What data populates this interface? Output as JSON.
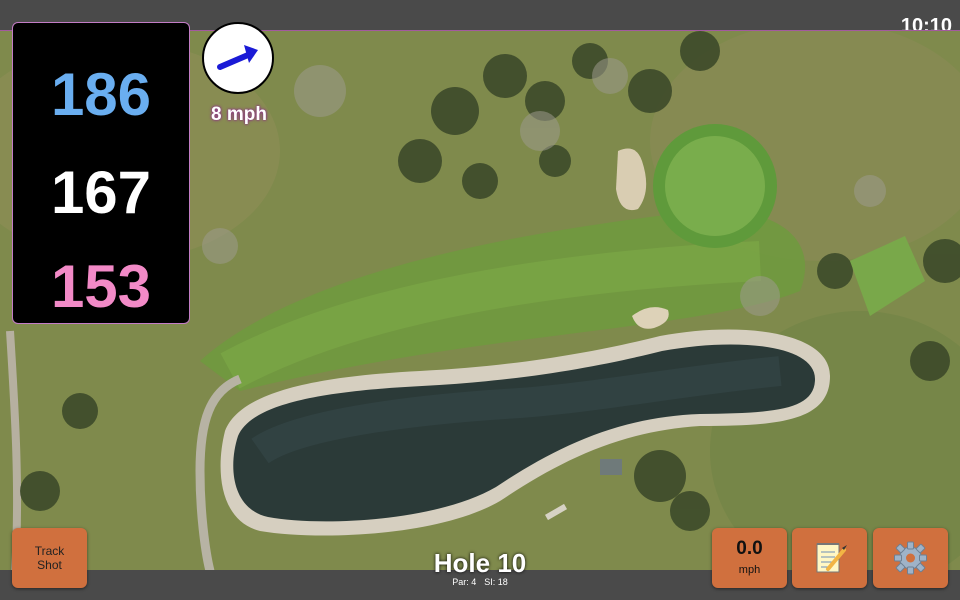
{
  "status": {
    "clock": "10:10"
  },
  "distances": {
    "back": "186",
    "middle": "167",
    "front": "153"
  },
  "wind": {
    "speed": "8 mph",
    "arrow_color": "#1a1ad6"
  },
  "hole": {
    "title": "Hole 10",
    "par": "Par: 4",
    "stroke_index": "SI: 18"
  },
  "buttons": {
    "track_shot_line1": "Track",
    "track_shot_line2": "Shot",
    "speed_value": "0.0",
    "speed_unit": "mph",
    "notes_icon": "notepad-icon",
    "settings_icon": "gear-icon"
  },
  "colors": {
    "back_distance": "#6aaef0",
    "middle_distance": "#ffffff",
    "front_distance": "#f28ac7",
    "button_bg": "#d0703e"
  }
}
